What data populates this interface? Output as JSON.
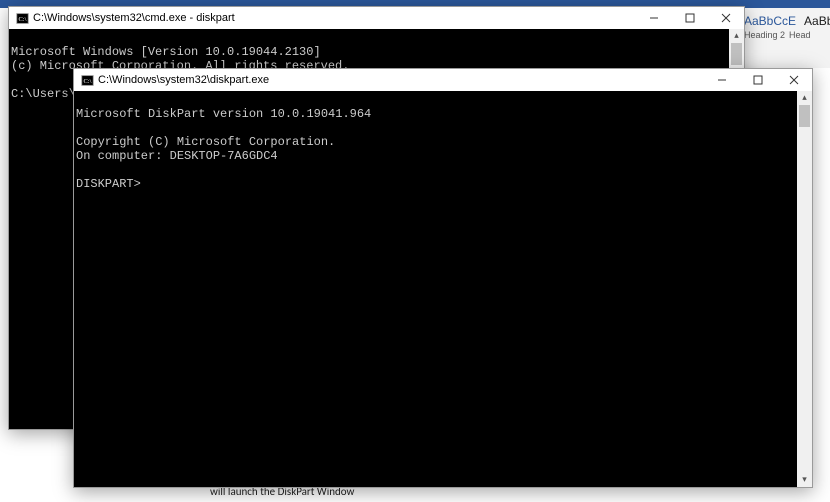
{
  "ribbon": {
    "hidden_tabs_text": ""
  },
  "styles": {
    "sample1": "AaBbCcE",
    "sample2": "AaBb",
    "label1": "Heading 2",
    "label2": "Head"
  },
  "cmd_window": {
    "title": "C:\\Windows\\system32\\cmd.exe - diskpart",
    "line1": "Microsoft Windows [Version 10.0.19044.2130]",
    "line2": "(c) Microsoft Corporation. All rights reserved.",
    "prompt": "C:\\Users\\hp"
  },
  "diskpart_window": {
    "title": "C:\\Windows\\system32\\diskpart.exe",
    "line1": "Microsoft DiskPart version 10.0.19041.964",
    "line2": "Copyright (C) Microsoft Corporation.",
    "line3": "On computer: DESKTOP-7A6GDC4",
    "prompt": "DISKPART>"
  },
  "caption": "will launch the DiskPart Window"
}
